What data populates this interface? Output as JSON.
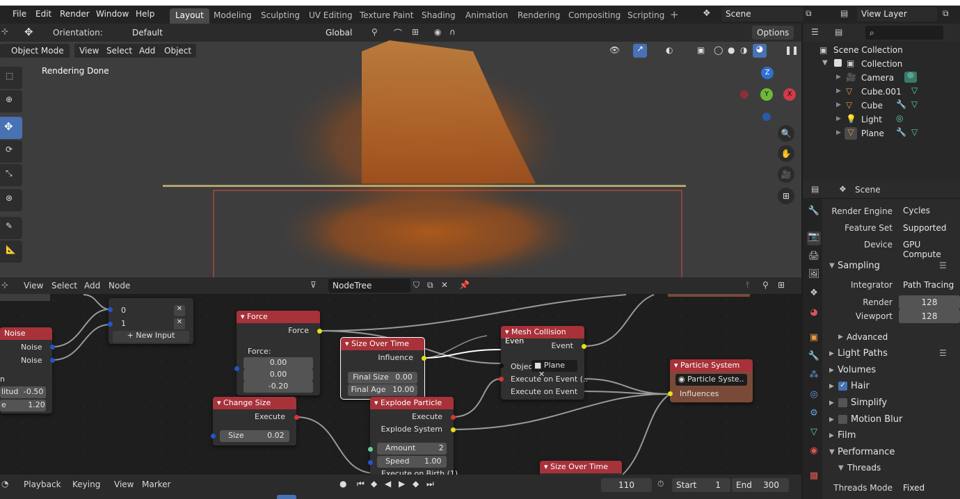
{
  "app": {
    "title": "Blender"
  },
  "menu": [
    "File",
    "Edit",
    "Render",
    "Window",
    "Help"
  ],
  "workspaces": [
    "Layout",
    "Modeling",
    "Sculpting",
    "UV Editing",
    "Texture Paint",
    "Shading",
    "Animation",
    "Rendering",
    "Compositing",
    "Scripting"
  ],
  "scene_selector": "Scene",
  "view_layer": "View Layer",
  "viewport": {
    "orientation_label": "Orientation:",
    "orientation_value": "Default",
    "transform_space": "Global",
    "options_label": "Options",
    "mode": "Object Mode",
    "header_menu": [
      "View",
      "Select",
      "Add",
      "Object"
    ],
    "status_text": "Rendering Done",
    "gizmo": {
      "z": "Z",
      "y": "Y",
      "x": "X"
    }
  },
  "node_editor": {
    "header_menu": [
      "View",
      "Select",
      "Add",
      "Node"
    ],
    "tree_name": "NodeTree",
    "nodes": {
      "list": {
        "items": [
          "0",
          "1"
        ],
        "add_input": "New Input"
      },
      "noise": {
        "title": "Noise",
        "outputs": [
          "Noise",
          "Noise"
        ],
        "fields": [
          {
            "label": "n",
            "value": ""
          },
          {
            "label": "litud",
            "value": "-0.50"
          },
          {
            "label": "e",
            "value": "1.20"
          }
        ]
      },
      "force": {
        "title": "Force",
        "output": "Force",
        "input_label": "Force:",
        "values": [
          "0.00",
          "0.00",
          "-0.20"
        ]
      },
      "size_over_time": {
        "title": "Size Over Time",
        "output": "Influence",
        "final_size_label": "Final Size",
        "final_size": "0.00",
        "final_age_label": "Final Age",
        "final_age": "10.00"
      },
      "change_size": {
        "title": "Change Size",
        "output": "Execute",
        "size_label": "Size",
        "size": "0.02"
      },
      "explode": {
        "title": "Explode Particle",
        "outputs": [
          "Execute",
          "Explode System"
        ],
        "amount_label": "Amount",
        "amount": "2",
        "speed_label": "Speed",
        "speed": "1.00",
        "footer": "Execute on Birth (1)"
      },
      "mesh_collision": {
        "title": "Mesh Collision Even",
        "output": "Event",
        "object_label": "Objec",
        "object_value": "Plane",
        "execute_event": "Execute on Event (..",
        "execute_event2": "Execute on Event"
      },
      "particle_system": {
        "title": "Particle System",
        "value": "Particle Syste..",
        "influences": "Influences"
      },
      "size_over_time_2": {
        "title": "Size Over Time"
      }
    }
  },
  "outliner": {
    "root": "Scene Collection",
    "collection": "Collection",
    "items": [
      "Camera",
      "Cube.001",
      "Cube",
      "Light",
      "Plane"
    ]
  },
  "properties": {
    "header": "Scene",
    "render_engine_label": "Render Engine",
    "render_engine": "Cycles",
    "feature_set_label": "Feature Set",
    "feature_set": "Supported",
    "device_label": "Device",
    "device": "GPU Compute",
    "sampling": "Sampling",
    "integrator_label": "Integrator",
    "integrator": "Path Tracing",
    "render_label": "Render",
    "render_samples": "128",
    "viewport_label": "Viewport",
    "viewport_samples": "128",
    "advanced": "Advanced",
    "panels": [
      "Light Paths",
      "Volumes",
      "Hair",
      "Simplify",
      "Motion Blur",
      "Film",
      "Performance"
    ],
    "threads": "Threads",
    "threads_mode_label": "Threads Mode",
    "threads_mode": "Fixed"
  },
  "timeline": {
    "menu": [
      "Playback",
      "Keying",
      "View",
      "Marker"
    ],
    "current_frame": "110",
    "start_label": "Start",
    "start": "1",
    "end_label": "End",
    "end": "300"
  },
  "colors": {
    "accent": "#4772b3",
    "node_header": "#a8323a",
    "particle": "#c8762a"
  }
}
